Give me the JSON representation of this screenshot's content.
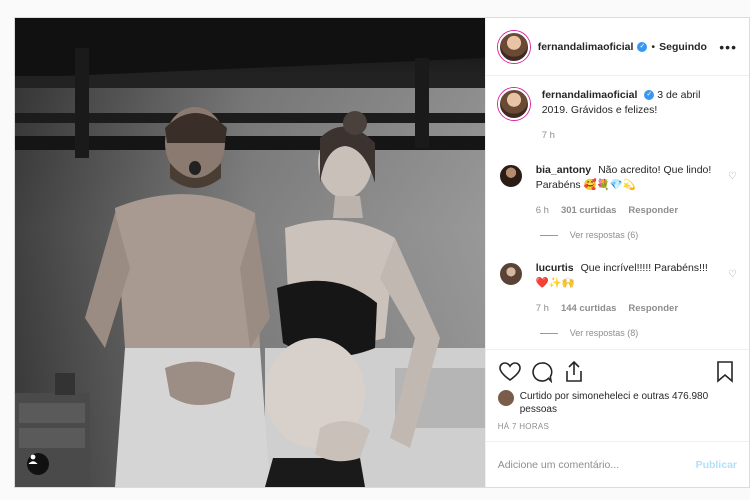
{
  "post": {
    "author": "fernandalimaoficial",
    "dot": "•",
    "follow_state": "Seguindo",
    "more": "•••"
  },
  "caption": {
    "user": "fernandalimaoficial",
    "text": "3 de abril 2019. Grávidos e felizes!",
    "time": "7 h"
  },
  "comments": [
    {
      "user": "bia_antony",
      "text": "Não acredito! Que lindo! Parabéns 🥰💐💎💫",
      "time": "6 h",
      "likes": "301 curtidas",
      "reply": "Responder",
      "view_replies": "Ver respostas (6)"
    },
    {
      "user": "lucurtis",
      "text": "Que incrível!!!!! Parabéns!!! ❤️✨🙌",
      "time": "7 h",
      "likes": "144 curtidas",
      "reply": "Responder",
      "view_replies": "Ver respostas (8)"
    }
  ],
  "likes": {
    "text": "Curtido por simoneheleci e outras 476.980 pessoas"
  },
  "posted": "HÁ 7 HORAS",
  "add_comment": {
    "placeholder": "Adicione um comentário...",
    "publish": "Publicar"
  },
  "icons": {
    "like": "heart-icon",
    "comment": "comment-icon",
    "share": "share-icon",
    "save": "bookmark-icon",
    "tag": "user-tag-icon"
  },
  "colors": {
    "verified": "#3897f0",
    "publish": "#b2dffc",
    "muted": "#8e8e8e"
  }
}
